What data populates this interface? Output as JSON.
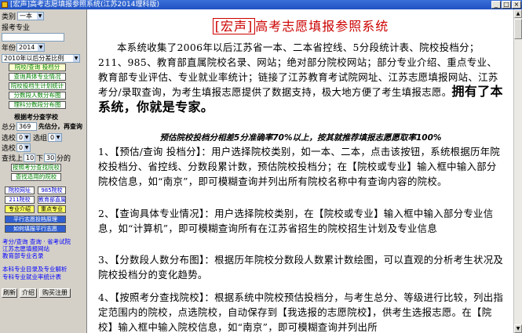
{
  "window": {
    "title": "[宏声]高考志愿填报参照系统(江苏2014理科版)"
  },
  "sidebar": {
    "category_label": "类别",
    "category_value": "一本",
    "major_label": "报考专业",
    "year_label": "年份",
    "year_value": "2014",
    "ratio_select": "2010年以后分差比例",
    "buttons": [
      "院校/查询 投档分",
      "查询具体专业情况",
      "院校投档生计划统计",
      "分数段人数分布图",
      "理科分数段分布图"
    ],
    "rank_section_title": "根据考分查学校",
    "score_label": "总分",
    "score_value": "369",
    "first_choice_label": "先估分，再查询",
    "tier_label": "选校",
    "tier_value": "0",
    "tier2_label": "选组",
    "tier2_value": "0",
    "check_label": "选校",
    "check_value": "0",
    "range_label": "查找上",
    "range_value": "10",
    "range_mid": "下",
    "range_value2": "30",
    "range_unit": "分的",
    "green_buttons": [
      "按照考分查找院校",
      "查找适用的院校"
    ],
    "grid_buttons": [
      {
        "label": "院校网址",
        "style": "normal"
      },
      {
        "label": "985院校",
        "style": "normal"
      },
      {
        "label": "211院校",
        "style": "normal"
      },
      {
        "label": "教育部直属",
        "style": "normal"
      },
      {
        "label": "专业介绍",
        "style": "yel"
      },
      {
        "label": "重点专业",
        "style": "yel"
      },
      {
        "label": "平行志愿投档原理",
        "style": "blue"
      },
      {
        "label": "如何填报平行志愿",
        "style": "blue"
      }
    ],
    "links": [
      "考分/查询 查询 · 省考试院",
      "江苏志愿填报网站",
      "教育部专业名录"
    ],
    "links2": [
      "本科专业目录及专业解析",
      "专科专业就业率统计表"
    ],
    "bottom_buttons": [
      "刷新",
      "介绍",
      "购买注册"
    ]
  },
  "main": {
    "headline_box": "[宏声]",
    "headline_rest": "高考志愿填报参照系统",
    "intro": "本系统收集了2006年以后江苏省一本、二本省控线、5分段统计表、院校投档分；211、985、教育部直属院校名录、网站；绝对部分院校网站；部分专业介绍、重点专业、教育部专业评估、专业就业率统计；链接了江苏教育考试院网址、江苏志愿填报网站、江苏考分/录取查询，为考生填报志愿提供了数据支持，极大地方便了考生填报志愿。",
    "slogan": "拥有了本系统，你就是专家。",
    "italic_line": "预估院校投档分相差5分准确率70%以上，按其就推荐填报志愿愿取率100%",
    "sections": [
      "1、【预估/查询 投档分】：用户选择院校类别，如一本、二本，点击该按钮，系统根据历年院校投档分、省控线、分数段累计数，预估院校投档分；在【院校或专业】输入框中输入部分院校信息，如“南京”，即可模糊查询并列出所有院校名称中有查询内容的院校。",
      "2、【查询具体专业情况】：用户选择院校类别，在【院校或专业】输入框中输入部分专业信息，如“计算机”，即可模糊查询所有在江苏省招生的院校招生计划及专业信息",
      "3、【分数段人数分布图】：根据历年院校分数段人数累计数绘图，可以直观的分析考生状况及院校投档分的变化趋势。",
      "4、【按照考分查找院校】：根据系统中院校预估投档分，与考生总分、等级进行比较，列出指定范围内的院校，点选院校，自动保存到【我选报的志愿院校】，供考生选报志愿。在【院校】输入框中输入院校信息，如“南京”，即可模糊查询并列出所"
    ]
  }
}
